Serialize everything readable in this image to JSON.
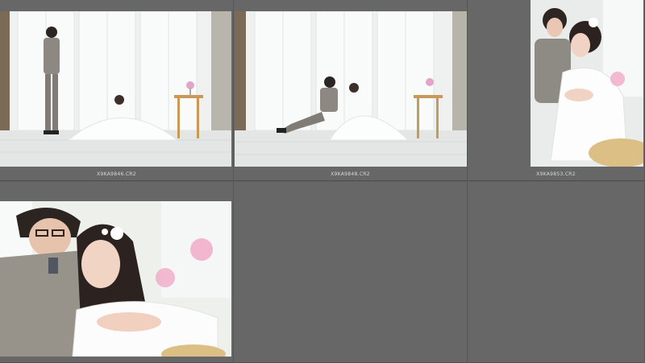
{
  "thumbnails": [
    {
      "filename": "X9KA9846.CR2",
      "alt_subject": "couple standing and seated by windows"
    },
    {
      "filename": "X9KA9848.CR2",
      "alt_subject": "couple seated on white floor"
    },
    {
      "filename": "X9KA9853.CR2",
      "alt_subject": "couple close portrait"
    },
    {
      "filename": "",
      "alt_subject": "couple close-up smiling"
    }
  ],
  "colors": {
    "background": "#5f5f5f",
    "cell": "#676767",
    "label_text": "#d9d9d9"
  }
}
